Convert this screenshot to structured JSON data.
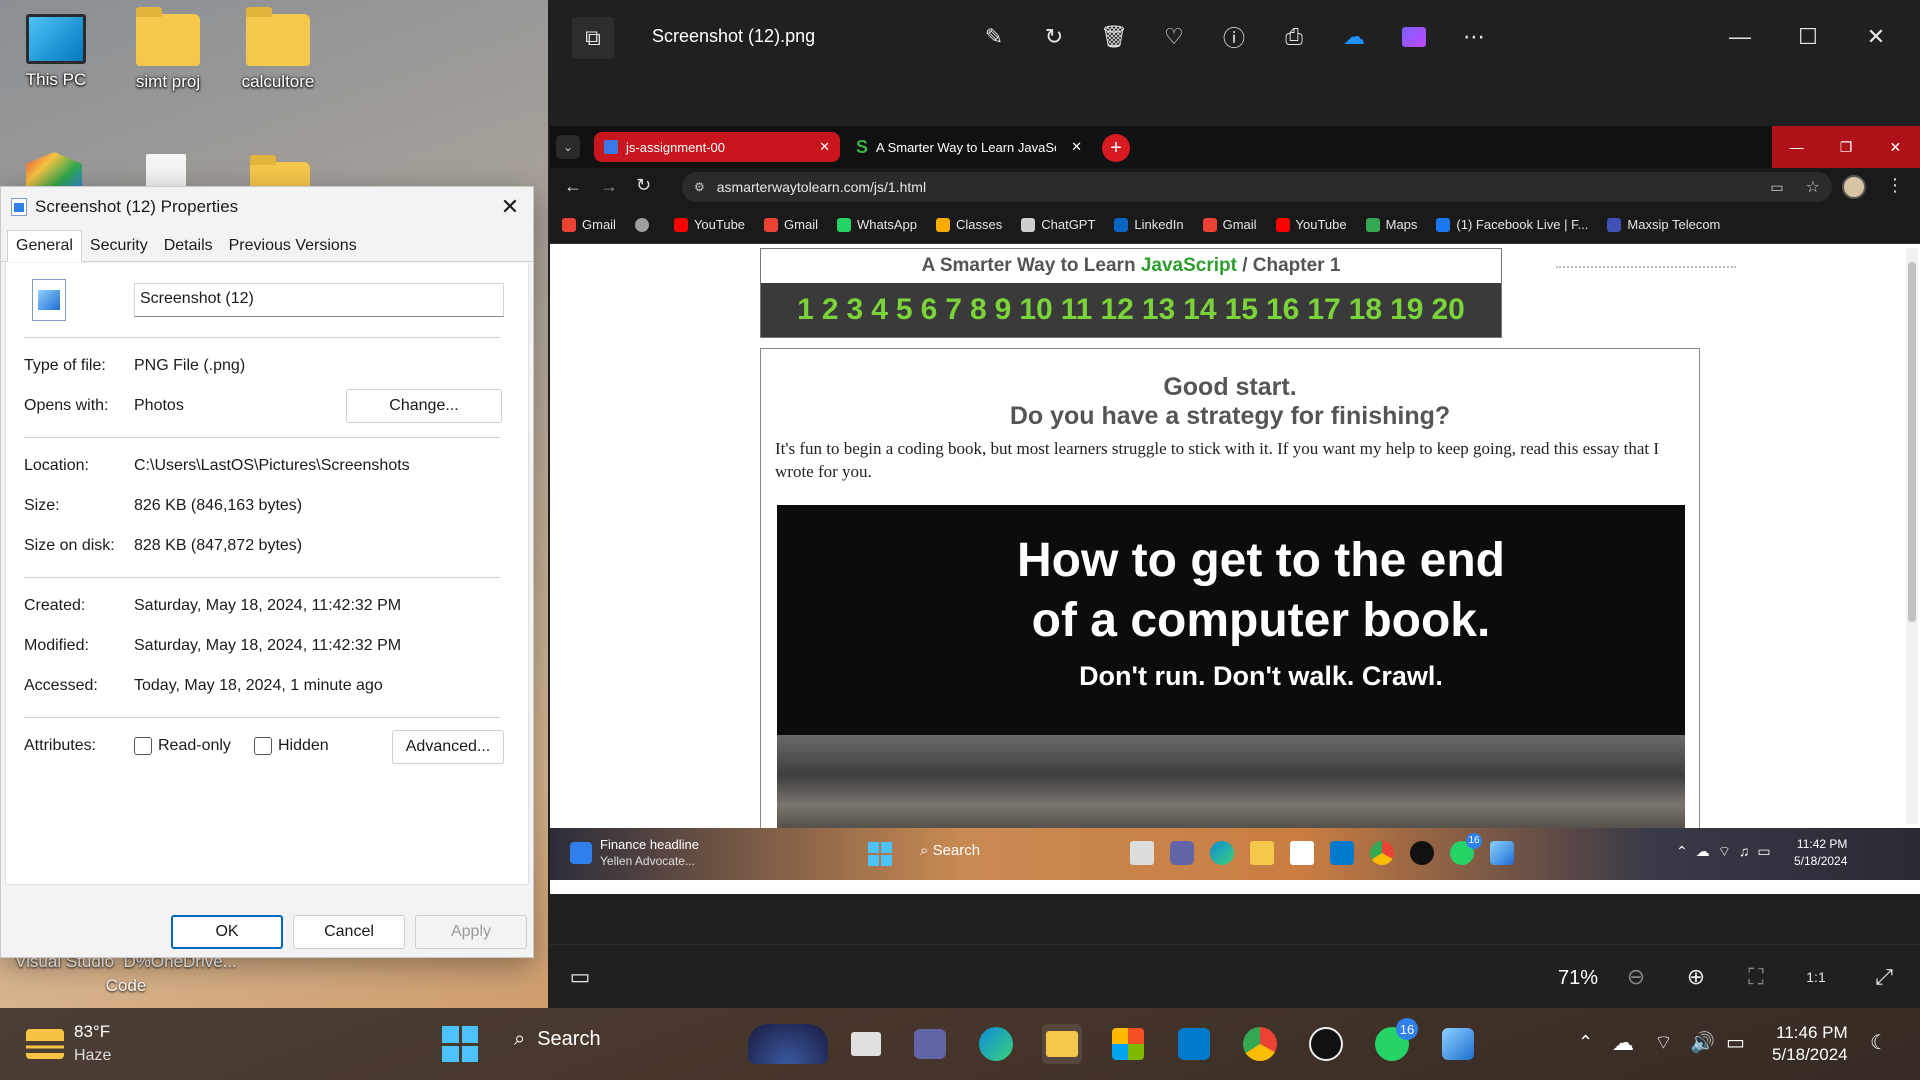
{
  "desktop": {
    "icons": [
      {
        "label": "This PC"
      },
      {
        "label": "simt proj"
      },
      {
        "label": "calcultore"
      }
    ],
    "partial_label": "Visual Studio  D%OneDrive...\nCode"
  },
  "properties": {
    "title": "Screenshot (12) Properties",
    "tabs": [
      "General",
      "Security",
      "Details",
      "Previous Versions"
    ],
    "filename": "Screenshot (12)",
    "type_label": "Type of file:",
    "type_value": "PNG File (.png)",
    "opens_label": "Opens with:",
    "opens_value": "Photos",
    "change_button": "Change...",
    "location_label": "Location:",
    "location_value": "C:\\Users\\LastOS\\Pictures\\Screenshots",
    "size_label": "Size:",
    "size_value": "826 KB (846,163 bytes)",
    "size_disk_label": "Size on disk:",
    "size_disk_value": "828 KB (847,872 bytes)",
    "created_label": "Created:",
    "created_value": "Saturday, May 18, 2024, 11:42:32 PM",
    "modified_label": "Modified:",
    "modified_value": "Saturday, May 18, 2024, 11:42:32 PM",
    "accessed_label": "Accessed:",
    "accessed_value": "Today, May 18, 2024, 1 minute ago",
    "attributes_label": "Attributes:",
    "readonly_label": "Read-only",
    "hidden_label": "Hidden",
    "advanced_button": "Advanced...",
    "ok": "OK",
    "cancel": "Cancel",
    "apply": "Apply"
  },
  "photos": {
    "title": "Screenshot (12).png",
    "zoom": "71%"
  },
  "browser": {
    "tab1": "js-assignment-00",
    "tab2": "A Smarter Way to Learn JavaScr",
    "url": "asmarterwaytolearn.com/js/1.html",
    "bookmarks": [
      {
        "label": "Gmail",
        "color": "#ea4335"
      },
      {
        "label": "",
        "color": "#9e9e9e"
      },
      {
        "label": "YouTube",
        "color": "#ff0000"
      },
      {
        "label": "Gmail",
        "color": "#ea4335"
      },
      {
        "label": "WhatsApp",
        "color": "#25d366"
      },
      {
        "label": "Classes",
        "color": "#f9ab00"
      },
      {
        "label": "ChatGPT",
        "color": "#cfcfcf"
      },
      {
        "label": "LinkedIn",
        "color": "#0a66c2"
      },
      {
        "label": "Gmail",
        "color": "#ea4335"
      },
      {
        "label": "YouTube",
        "color": "#ff0000"
      },
      {
        "label": "Maps",
        "color": "#34a853"
      },
      {
        "label": "(1) Facebook Live | F...",
        "color": "#1877f2"
      },
      {
        "label": "Maxsip Telecom",
        "color": "#3f51b5"
      }
    ],
    "page": {
      "header_prefix": "A Smarter Way to Learn ",
      "header_js": "JavaScript",
      "header_suffix": " / Chapter 1",
      "chapters": [
        "1",
        "2",
        "3",
        "4",
        "5",
        "6",
        "7",
        "8",
        "9",
        "10",
        "11",
        "12",
        "13",
        "14",
        "15",
        "16",
        "17",
        "18",
        "19",
        "20"
      ],
      "heading1": "Good start.",
      "heading2": "Do you have a strategy for finishing?",
      "paragraph": "It's fun to begin a coding book, but most learners struggle to stick with it. If you want my help to keep going, read this essay that I wrote for you.",
      "banner_line1": "How to get to the end",
      "banner_line2": "of a computer book.",
      "banner_line3": "Don't run. Don't walk. Crawl."
    },
    "inner_taskbar": {
      "news_title": "Finance headline",
      "news_sub": "Yellen Advocate...",
      "search": "Search",
      "badge": "16",
      "time": "11:42 PM",
      "date": "5/18/2024"
    }
  },
  "taskbar": {
    "weather_temp": "83°F",
    "weather_desc": "Haze",
    "search": "Search",
    "whatsapp_badge": "16",
    "time": "11:46 PM",
    "date": "5/18/2024"
  }
}
